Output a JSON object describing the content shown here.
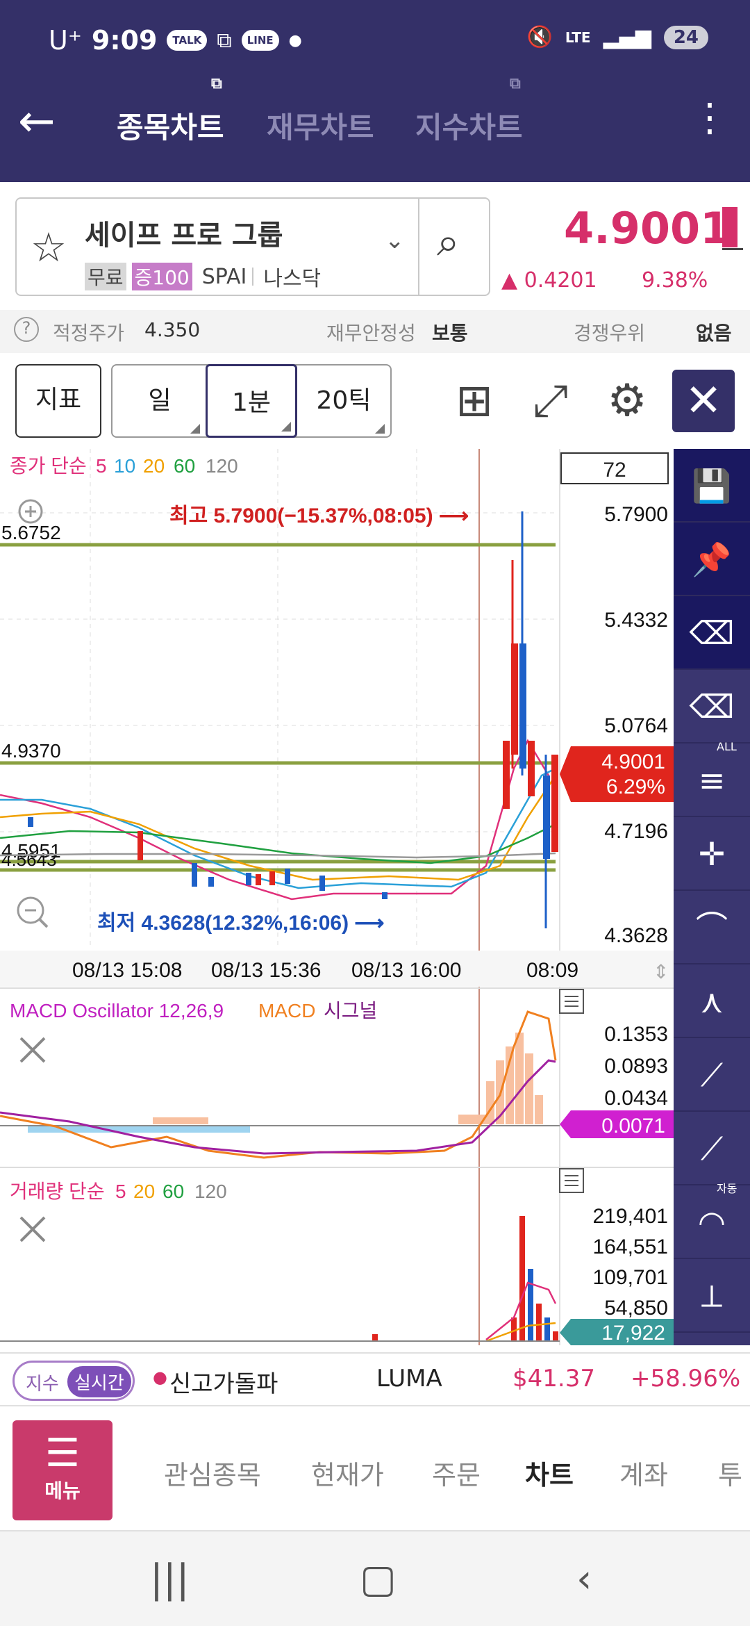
{
  "status": {
    "carrier": "U⁺",
    "time": "9:09",
    "bubbles": [
      "TALK",
      "LINE"
    ],
    "net": "LTE",
    "battery": "24"
  },
  "header": {
    "tabs": [
      "종목차트",
      "재무차트",
      "지수차트"
    ]
  },
  "stock": {
    "name": "세이프 프로 그룹",
    "badges": [
      "무료",
      "증100"
    ],
    "ticker": "SPAI",
    "market": "나스닥",
    "price": "4.9001",
    "change": "▲ 0.4201",
    "change_pct": "9.38%"
  },
  "valuation": {
    "fair_label": "적정주가",
    "fair_value": "4.350",
    "fin_label": "재무안정성",
    "fin_value": "보통",
    "comp_label": "경쟁우위",
    "comp_value": "없음"
  },
  "toolbar": {
    "indicator": "지표",
    "day": "일",
    "minute": "1분",
    "ticks": "20틱"
  },
  "main_chart": {
    "legend": {
      "title": "종가 단순",
      "periods": [
        "5",
        "10",
        "20",
        "60",
        "120"
      ],
      "colors": [
        "#e0307a",
        "#2aa0d8",
        "#f0a000",
        "#20a040",
        "#888888"
      ]
    },
    "count": "72",
    "high_label": "최고 5.7900(−15.37%,08:05) ⟶",
    "low_label": "최저 4.3628(12.32%,16:06) ⟶",
    "yticks": [
      "5.7900",
      "5.4332",
      "5.0764",
      "4.7196",
      "4.3628"
    ],
    "hlines": [
      "5.6752",
      "4.9370",
      "4.5951",
      "4.5643"
    ],
    "current": {
      "price": "4.9001",
      "pct": "6.29%"
    },
    "xlabels": [
      "08/13 15:08",
      "08/13 15:36",
      "08/13 16:00",
      "08:09"
    ]
  },
  "macd": {
    "legend": [
      "MACD Oscillator 12,26,9",
      "MACD",
      "시그널"
    ],
    "yticks": [
      "0.1353",
      "0.0893",
      "0.0434"
    ],
    "current": "0.0071"
  },
  "volume": {
    "legend": {
      "title": "거래량 단순",
      "periods": [
        "5",
        "20",
        "60",
        "120"
      ]
    },
    "yticks": [
      "219,401",
      "164,551",
      "109,701",
      "54,850"
    ],
    "current": "17,922"
  },
  "sidebar_icons": [
    "save-icon",
    "pin-remove-icon",
    "eraser-icon",
    "eraser-all-icon",
    "hcl-lines-icon",
    "cross-tool-icon",
    "trend-line-icon",
    "angle-tool-icon",
    "line-tool-icon",
    "auto-trend-icon",
    "arc-tool-icon",
    "fan-tool-icon"
  ],
  "sidebar_labels": {
    "all": "ALL",
    "auto": "자동"
  },
  "strip": {
    "idx": "지수",
    "realtime": "실시간",
    "signal": "신고가돌파",
    "symbol": "LUMA",
    "price": "$41.37",
    "pct": "+58.96%"
  },
  "bottomnav": {
    "menu": "메뉴",
    "items": [
      "관심종목",
      "현재가",
      "주문",
      "차트",
      "계좌",
      "투"
    ]
  }
}
